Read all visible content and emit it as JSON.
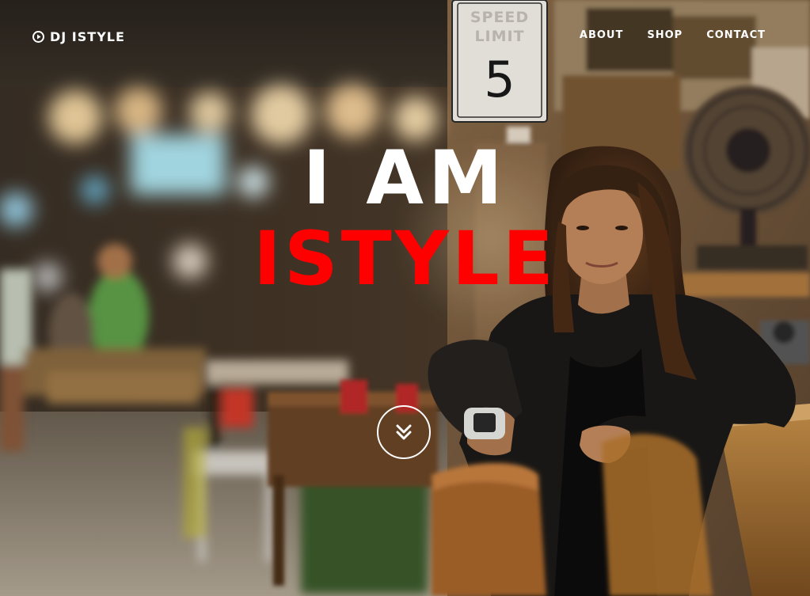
{
  "brand": {
    "name": "DJ ISTYLE",
    "icon": "play-circle-icon"
  },
  "nav": {
    "items": [
      {
        "label": "ABOUT"
      },
      {
        "label": "SHOP"
      },
      {
        "label": "CONTACT"
      }
    ]
  },
  "hero": {
    "line1": "I AM",
    "line2": "ISTYLE",
    "line2_color": "#ff0000",
    "scroll_icon": "double-chevron-down-icon",
    "background": {
      "speed_limit_sign": {
        "line1": "SPEED",
        "line2": "LIMIT",
        "number": "5"
      }
    }
  }
}
